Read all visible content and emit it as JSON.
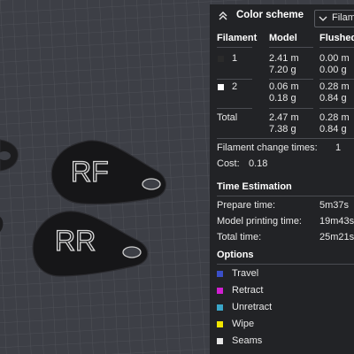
{
  "viewport": {
    "plates": [
      {
        "label": "RF"
      },
      {
        "label": "RR"
      }
    ]
  },
  "panel": {
    "color_scheme_title": "Color scheme",
    "scheme_select_value": "Filament",
    "table": {
      "headers": [
        "Filament",
        "Model",
        "Flushed"
      ],
      "rows": [
        {
          "filament": "1",
          "swatch_color": "#2a2a2a",
          "model_m": "2.41 m",
          "model_g": "7.20 g",
          "flushed_m": "0.00 m",
          "flushed_g": "0.00 g"
        },
        {
          "filament": "2",
          "swatch_color": "#ffffff",
          "model_m": "0.06 m",
          "model_g": "0.18 g",
          "flushed_m": "0.28 m",
          "flushed_g": "0.84 g"
        }
      ],
      "total": {
        "label": "Total",
        "model_m": "2.47 m",
        "model_g": "7.38 g",
        "flushed_m": "0.28 m",
        "flushed_g": "0.84 g"
      }
    },
    "filament_change_label": "Filament change times:",
    "filament_change_value": "1",
    "cost_label": "Cost:",
    "cost_value": "0.18",
    "time_estimation_title": "Time Estimation",
    "times": [
      {
        "label": "Prepare time:",
        "value": "5m37s"
      },
      {
        "label": "Model printing time:",
        "value": "19m43s"
      },
      {
        "label": "Total time:",
        "value": "25m21s"
      }
    ],
    "options_title": "Options",
    "options": [
      {
        "label": "Travel",
        "color": "#3a4fc8"
      },
      {
        "label": "Retract",
        "color": "#d21fd2"
      },
      {
        "label": "Unretract",
        "color": "#3aa6c8"
      },
      {
        "label": "Wipe",
        "color": "#f2e600"
      },
      {
        "label": "Seams",
        "color": "#e6e6e6"
      }
    ]
  }
}
